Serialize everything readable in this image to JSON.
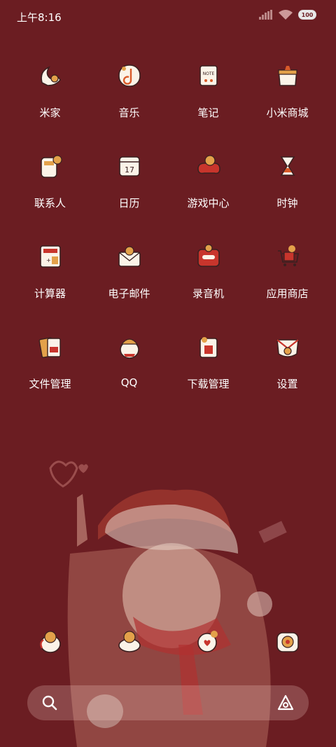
{
  "status_bar": {
    "time": "上午8:16",
    "battery": "100"
  },
  "apps": [
    [
      {
        "label": "米家",
        "icon": "mijia-icon"
      },
      {
        "label": "音乐",
        "icon": "music-icon"
      },
      {
        "label": "笔记",
        "icon": "notes-icon"
      },
      {
        "label": "小米商城",
        "icon": "mi-store-icon"
      }
    ],
    [
      {
        "label": "联系人",
        "icon": "contacts-icon"
      },
      {
        "label": "日历",
        "icon": "calendar-icon"
      },
      {
        "label": "游戏中心",
        "icon": "game-center-icon"
      },
      {
        "label": "时钟",
        "icon": "clock-icon"
      }
    ],
    [
      {
        "label": "计算器",
        "icon": "calculator-icon"
      },
      {
        "label": "电子邮件",
        "icon": "email-icon"
      },
      {
        "label": "录音机",
        "icon": "recorder-icon"
      },
      {
        "label": "应用商店",
        "icon": "app-store-icon"
      }
    ],
    [
      {
        "label": "文件管理",
        "icon": "file-manager-icon"
      },
      {
        "label": "QQ",
        "icon": "qq-icon"
      },
      {
        "label": "下载管理",
        "icon": "download-manager-icon"
      },
      {
        "label": "设置",
        "icon": "settings-icon"
      }
    ]
  ],
  "calendar_day": "17",
  "notes_badge": "NOTE",
  "dock": [
    "phone-icon",
    "messages-icon",
    "browser-icon",
    "camera-icon"
  ],
  "colors": {
    "background": "#6b1d22",
    "icon_bg": "#fbf3e8",
    "accent": "#d95b2a"
  }
}
